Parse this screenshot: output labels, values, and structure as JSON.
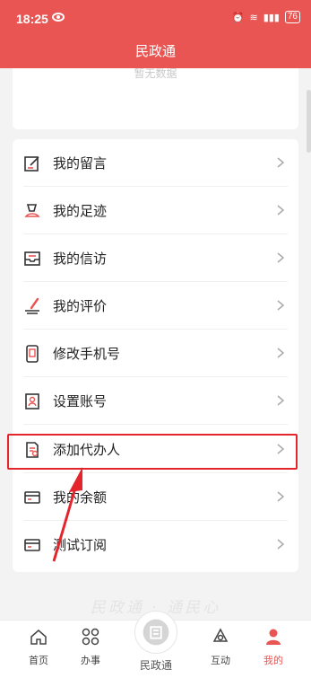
{
  "status_bar": {
    "time": "18:25",
    "right_text": "46 76"
  },
  "nav": {
    "title": "民政通"
  },
  "top_card": {
    "empty_text": "暂无数据"
  },
  "menu": {
    "items": [
      {
        "label": "我的留言",
        "icon": "message-edit-icon"
      },
      {
        "label": "我的足迹",
        "icon": "footprint-icon"
      },
      {
        "label": "我的信访",
        "icon": "mailbox-icon"
      },
      {
        "label": "我的评价",
        "icon": "evaluation-pen-icon"
      },
      {
        "label": "修改手机号",
        "icon": "phone-icon"
      },
      {
        "label": "设置账号",
        "icon": "account-settings-icon"
      },
      {
        "label": "添加代办人",
        "icon": "add-agent-document-icon"
      },
      {
        "label": "我的余额",
        "icon": "wallet-card-icon"
      },
      {
        "label": "测试订阅",
        "icon": "subscription-card-icon"
      }
    ]
  },
  "watermark": "民政通 · 通民心",
  "tabbar": {
    "tabs": [
      {
        "label": "首页",
        "icon": "home-icon"
      },
      {
        "label": "办事",
        "icon": "services-grid-icon"
      },
      {
        "label": "互动",
        "icon": "interaction-icon"
      },
      {
        "label": "我的",
        "icon": "user-icon"
      }
    ],
    "center_label": "民政通"
  },
  "colors": {
    "primary": "#e85552",
    "highlight": "#e4262c"
  }
}
